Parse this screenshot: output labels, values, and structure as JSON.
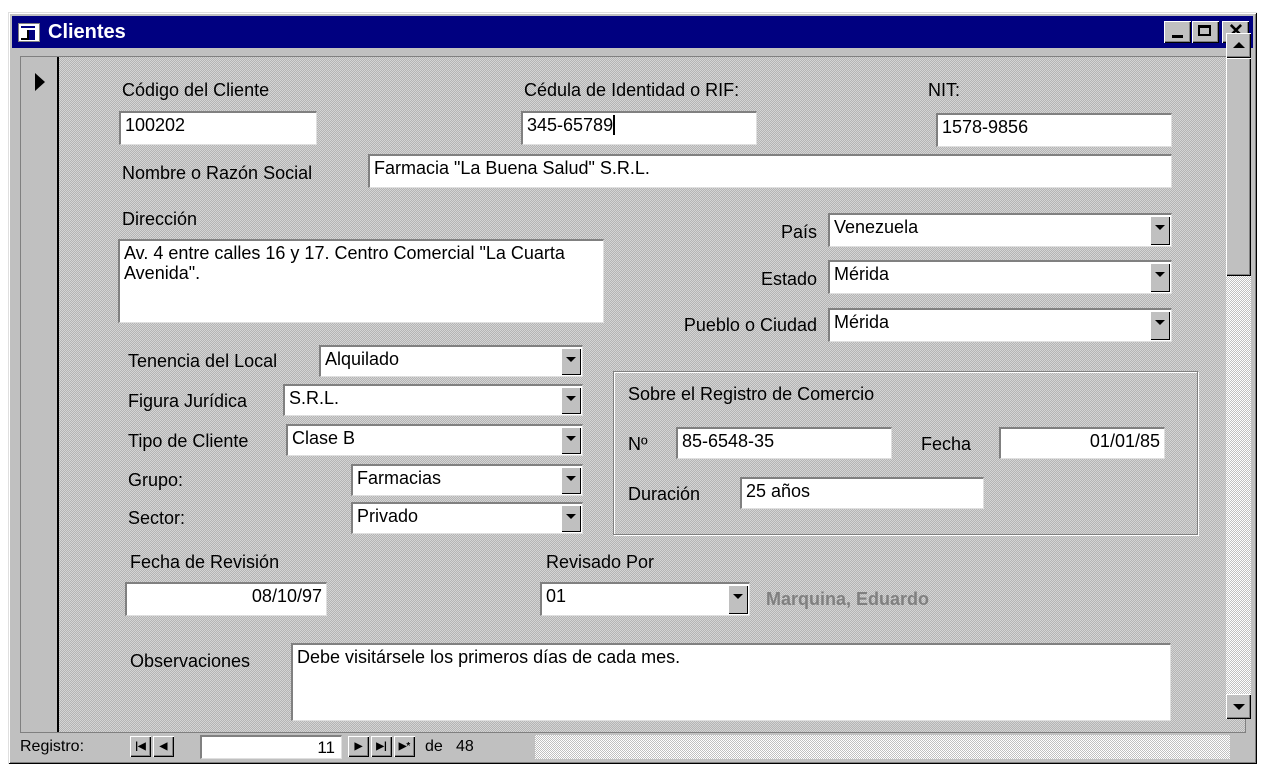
{
  "window": {
    "title": "Clientes",
    "icon": "form-icon"
  },
  "labels": {
    "codigo": "Código del Cliente",
    "cedula": "Cédula de Identidad o RIF:",
    "nit": "NIT:",
    "nombre": "Nombre o Razón Social",
    "direccion": "Dirección",
    "pais": "País",
    "estado": "Estado",
    "pueblo": "Pueblo o Ciudad",
    "tenencia": "Tenencia del Local",
    "figura": "Figura Jurídica",
    "tipo": "Tipo de Cliente",
    "grupo": "Grupo:",
    "sector": "Sector:",
    "registro_group": "Sobre el Registro de Comercio",
    "numero": "Nº",
    "fecha": "Fecha",
    "duracion": "Duración",
    "fecha_revision": "Fecha de Revisión",
    "revisado_por": "Revisado Por",
    "observaciones": "Observaciones"
  },
  "values": {
    "codigo": "100202",
    "cedula": "345-65789",
    "nit": "1578-9856",
    "nombre": "Farmacia \"La Buena Salud\" S.R.L.",
    "direccion": "Av. 4 entre calles 16 y 17. Centro Comercial \"La Cuarta Avenida\".",
    "pais": "Venezuela",
    "estado": "Mérida",
    "pueblo": "Mérida",
    "tenencia": "Alquilado",
    "figura": "S.R.L.",
    "tipo": "Clase B",
    "grupo": "Farmacias",
    "sector": "Privado",
    "numero": "85-6548-35",
    "fecha": "01/01/85",
    "duracion": "25 años",
    "fecha_revision": "08/10/97",
    "revisado_por": "01",
    "revisor_nombre": "Marquina, Eduardo",
    "observaciones": "Debe visitársele los primeros días de cada mes."
  },
  "navigation": {
    "label": "Registro:",
    "current": "11",
    "of_label": "de",
    "total": "48"
  }
}
